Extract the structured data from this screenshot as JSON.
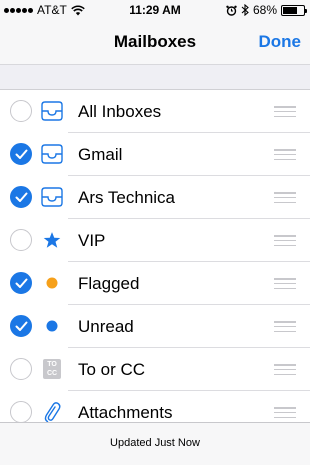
{
  "status_bar": {
    "carrier": "AT&T",
    "time": "11:29 AM",
    "battery": "68%",
    "battery_level": 0.68
  },
  "nav": {
    "title": "Mailboxes",
    "done": "Done"
  },
  "mailboxes": [
    {
      "label": "All Inboxes",
      "checked": false,
      "icon": "inbox-tray-icon"
    },
    {
      "label": "Gmail",
      "checked": true,
      "icon": "inbox-tray-icon"
    },
    {
      "label": "Ars Technica",
      "checked": true,
      "icon": "inbox-tray-icon"
    },
    {
      "label": "VIP",
      "checked": false,
      "icon": "star-icon"
    },
    {
      "label": "Flagged",
      "checked": true,
      "icon": "orange-dot-icon"
    },
    {
      "label": "Unread",
      "checked": true,
      "icon": "blue-dot-icon"
    },
    {
      "label": "To or CC",
      "checked": false,
      "icon": "to-cc-icon",
      "icon_text_top": "TO",
      "icon_text_bottom": "CC"
    },
    {
      "label": "Attachments",
      "checked": false,
      "icon": "paperclip-icon"
    }
  ],
  "bottom_bar": {
    "status": "Updated Just Now"
  },
  "colors": {
    "accent": "#1b77e5",
    "flag": "#f6a01a",
    "unread": "#1b77e5"
  }
}
